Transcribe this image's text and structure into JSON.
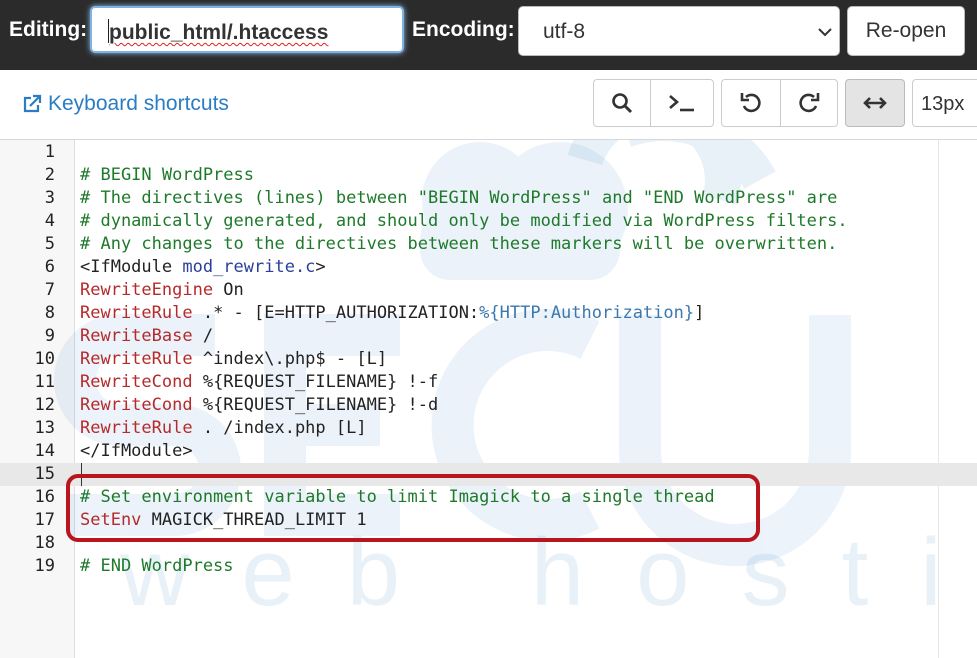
{
  "header": {
    "editing_label": "Editing:",
    "file_path": "public_html/.htaccess",
    "encoding_label": "Encoding:",
    "encoding_value": "utf-8",
    "reopen_label": "Re-open"
  },
  "toolbar": {
    "keyboard_shortcuts": "Keyboard shortcuts",
    "font_size": "13px"
  },
  "editor": {
    "lines": [
      {
        "num": "1",
        "segments": []
      },
      {
        "num": "2",
        "segments": [
          {
            "t": "# BEGIN WordPress",
            "c": "comment"
          }
        ]
      },
      {
        "num": "3",
        "segments": [
          {
            "t": "# The directives (lines) between \"BEGIN WordPress\" and \"END WordPress\" are",
            "c": "comment"
          }
        ]
      },
      {
        "num": "4",
        "segments": [
          {
            "t": "# dynamically generated, and should only be modified via WordPress filters.",
            "c": "comment"
          }
        ]
      },
      {
        "num": "5",
        "segments": [
          {
            "t": "# Any changes to the directives between these markers will be overwritten.",
            "c": "comment"
          }
        ]
      },
      {
        "num": "6",
        "segments": [
          {
            "t": "<IfModule ",
            "c": "tag"
          },
          {
            "t": "mod_rewrite.c",
            "c": "attr"
          },
          {
            "t": ">",
            "c": "tag"
          }
        ]
      },
      {
        "num": "7",
        "segments": [
          {
            "t": "RewriteEngine",
            "c": "kw"
          },
          {
            "t": " On",
            "c": "plain"
          }
        ]
      },
      {
        "num": "8",
        "segments": [
          {
            "t": "RewriteRule",
            "c": "kw"
          },
          {
            "t": " .* - [E=HTTP_AUTHORIZATION:",
            "c": "plain"
          },
          {
            "t": "%{HTTP:Authorization}",
            "c": "var"
          },
          {
            "t": "]",
            "c": "plain"
          }
        ]
      },
      {
        "num": "9",
        "segments": [
          {
            "t": "RewriteBase",
            "c": "kw"
          },
          {
            "t": " /",
            "c": "plain"
          }
        ]
      },
      {
        "num": "10",
        "segments": [
          {
            "t": "RewriteRule",
            "c": "kw"
          },
          {
            "t": " ^index\\.php$ - [L]",
            "c": "plain"
          }
        ]
      },
      {
        "num": "11",
        "segments": [
          {
            "t": "RewriteCond",
            "c": "kw"
          },
          {
            "t": " %{REQUEST_FILENAME} !-f",
            "c": "plain"
          }
        ]
      },
      {
        "num": "12",
        "segments": [
          {
            "t": "RewriteCond",
            "c": "kw"
          },
          {
            "t": " %{REQUEST_FILENAME} !-d",
            "c": "plain"
          }
        ]
      },
      {
        "num": "13",
        "segments": [
          {
            "t": "RewriteRule",
            "c": "kw"
          },
          {
            "t": " . /index.php [L]",
            "c": "plain"
          }
        ]
      },
      {
        "num": "14",
        "segments": [
          {
            "t": "</IfModule>",
            "c": "tag"
          }
        ]
      },
      {
        "num": "15",
        "segments": [],
        "active": true
      },
      {
        "num": "16",
        "segments": [
          {
            "t": "# Set environment variable to limit Imagick to a single thread",
            "c": "comment"
          }
        ]
      },
      {
        "num": "17",
        "segments": [
          {
            "t": "SetEnv",
            "c": "kw"
          },
          {
            "t": " MAGICK_THREAD_LIMIT 1",
            "c": "plain"
          }
        ]
      },
      {
        "num": "18",
        "segments": []
      },
      {
        "num": "19",
        "segments": [
          {
            "t": "# END WordPress",
            "c": "comment"
          }
        ]
      }
    ]
  },
  "watermark": {
    "brand_text": "SECU",
    "tagline": "web hosting"
  },
  "colors": {
    "comment": "#1e7a2a",
    "keyword": "#b52a2a",
    "link": "#2a7dc4",
    "highlight_box": "#b8151f",
    "topbar": "#2b2b2b"
  }
}
